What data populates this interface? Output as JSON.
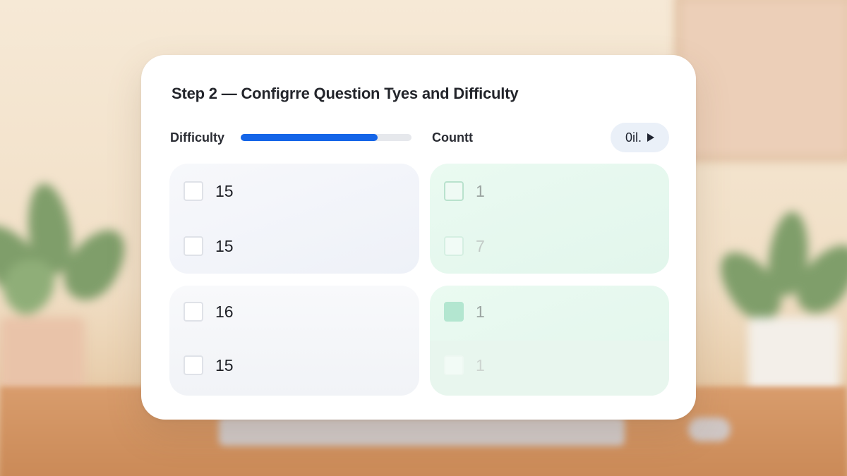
{
  "dialog": {
    "title": "Step 2  — Configrre Question Tyes and Difficulty",
    "difficulty_label": "Difficulty",
    "difficulty_level": 0.8,
    "count_label": "Countt",
    "action_button_label": "0il.",
    "action_button_icon": "play-icon"
  },
  "groups": [
    {
      "left": [
        {
          "value": "15",
          "checked": false
        },
        {
          "value": "15",
          "checked": false
        }
      ],
      "right": [
        {
          "value": "1",
          "checked": false
        },
        {
          "value": "7",
          "checked": false
        }
      ]
    },
    {
      "left": [
        {
          "value": "16",
          "checked": false
        },
        {
          "value": "15",
          "checked": false
        }
      ],
      "right": [
        {
          "value": "1",
          "checked": true
        },
        {
          "value": "1",
          "checked": false
        }
      ]
    }
  ],
  "colors": {
    "accent": "#1565e8",
    "panel_left": "#eef1f8",
    "panel_right": "#e2f6ec",
    "checked_box": "#b3e6d0"
  }
}
